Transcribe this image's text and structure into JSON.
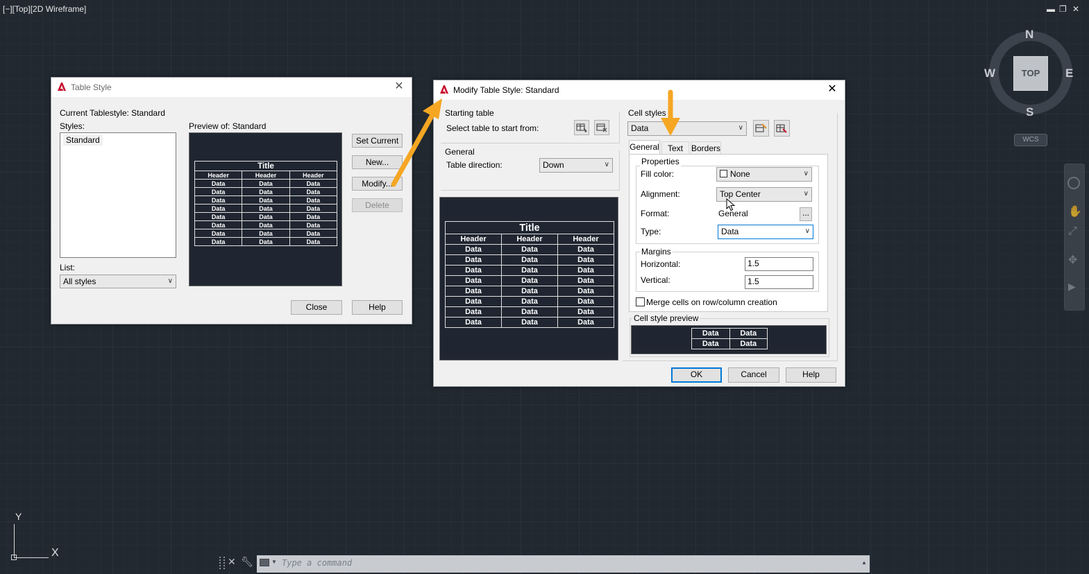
{
  "viewport": {
    "label": "[−][Top][2D Wireframe]",
    "window_controls": {
      "minimize": "▬",
      "restore": "❐",
      "close": "✕"
    }
  },
  "viewcube": {
    "north": "N",
    "south": "S",
    "east": "E",
    "west": "W",
    "face": "TOP",
    "wcs": "WCS"
  },
  "ucs": {
    "y": "Y",
    "x": "X"
  },
  "command_line": {
    "placeholder": "Type a command"
  },
  "table_style_dialog": {
    "title": "Table Style",
    "current_label": "Current Tablestyle: Standard",
    "styles_label": "Styles:",
    "styles": [
      "Standard"
    ],
    "preview_label": "Preview of: Standard",
    "list_label": "List:",
    "list_value": "All styles",
    "buttons": {
      "set_current": "Set Current",
      "new": "New...",
      "modify": "Modify...",
      "delete": "Delete",
      "close": "Close",
      "help": "Help"
    }
  },
  "preview_table": {
    "title": "Title",
    "headers": [
      "Header",
      "Header",
      "Header"
    ],
    "rows": [
      [
        "Data",
        "Data",
        "Data"
      ],
      [
        "Data",
        "Data",
        "Data"
      ],
      [
        "Data",
        "Data",
        "Data"
      ],
      [
        "Data",
        "Data",
        "Data"
      ],
      [
        "Data",
        "Data",
        "Data"
      ],
      [
        "Data",
        "Data",
        "Data"
      ],
      [
        "Data",
        "Data",
        "Data"
      ],
      [
        "Data",
        "Data",
        "Data"
      ]
    ]
  },
  "modify_dialog": {
    "title": "Modify Table Style: Standard",
    "starting_table_label": "Starting table",
    "select_table_label": "Select table to start from:",
    "general_group": "General",
    "table_direction_label": "Table direction:",
    "table_direction_value": "Down",
    "cell_styles_label": "Cell styles",
    "cell_style_value": "Data",
    "tabs": [
      "General",
      "Text",
      "Borders"
    ],
    "properties_label": "Properties",
    "fill_color_label": "Fill color:",
    "fill_color_value": "None",
    "alignment_label": "Alignment:",
    "alignment_value": "Top Center",
    "format_label": "Format:",
    "format_value": "General",
    "format_button": "...",
    "type_label": "Type:",
    "type_value": "Data",
    "margins_label": "Margins",
    "horizontal_label": "Horizontal:",
    "horizontal_value": "1.5",
    "vertical_label": "Vertical:",
    "vertical_value": "1.5",
    "merge_label": "Merge cells on row/column creation",
    "cell_preview_label": "Cell style preview",
    "cell_preview": [
      [
        "Data",
        "Data"
      ],
      [
        "Data",
        "Data"
      ]
    ],
    "buttons": {
      "ok": "OK",
      "cancel": "Cancel",
      "help": "Help"
    }
  },
  "colors": {
    "annotation_arrow": "#f5a623",
    "canvas": "#212830",
    "autocad_red": "#c8102e"
  }
}
